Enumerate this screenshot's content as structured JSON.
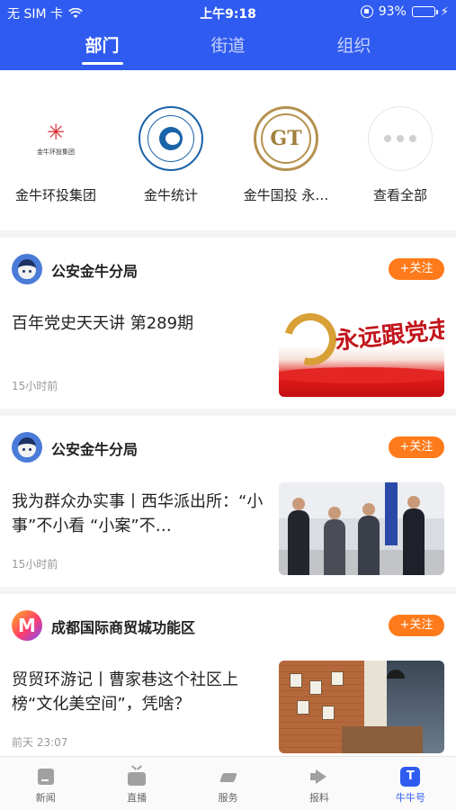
{
  "status": {
    "carrier": "无 SIM 卡",
    "time": "上午9:18",
    "battery": "93%",
    "battery_level": 0.93
  },
  "tabs": [
    {
      "label": "部门",
      "active": true
    },
    {
      "label": "街道",
      "active": false
    },
    {
      "label": "组织",
      "active": false
    }
  ],
  "departments": [
    {
      "name": "金牛环投集团",
      "logo_text": "金牛环投集团"
    },
    {
      "name": "金牛统计"
    },
    {
      "name": "金牛国投 永…"
    },
    {
      "name": "查看全部"
    }
  ],
  "feed": [
    {
      "source": "公安金牛分局",
      "follow_label": "+关注",
      "title": "百年党史天天讲 第289期",
      "time": "15小时前",
      "thumb_text": "永远跟党走"
    },
    {
      "source": "公安金牛分局",
      "follow_label": "+关注",
      "title": "我为群众办实事丨西华派出所：“小事”不小看 “小案”不…",
      "time": "15小时前"
    },
    {
      "source": "成都国际商贸城功能区",
      "avatar_letter": "M",
      "follow_label": "+关注",
      "title": "贸贸环游记丨曹家巷这个社区上榜“文化美空间”，凭啥？",
      "time": "前天 23:07"
    }
  ],
  "bottom_nav": [
    {
      "label": "新闻",
      "icon": "news-icon"
    },
    {
      "label": "直播",
      "icon": "tv-icon"
    },
    {
      "label": "服务",
      "icon": "service-icon"
    },
    {
      "label": "报料",
      "icon": "megaphone-icon"
    },
    {
      "label": "牛牛号",
      "icon": "niuniu-icon",
      "active": true
    }
  ],
  "colors": {
    "brand": "#2f5bf0",
    "follow": "#ff7a1a"
  }
}
